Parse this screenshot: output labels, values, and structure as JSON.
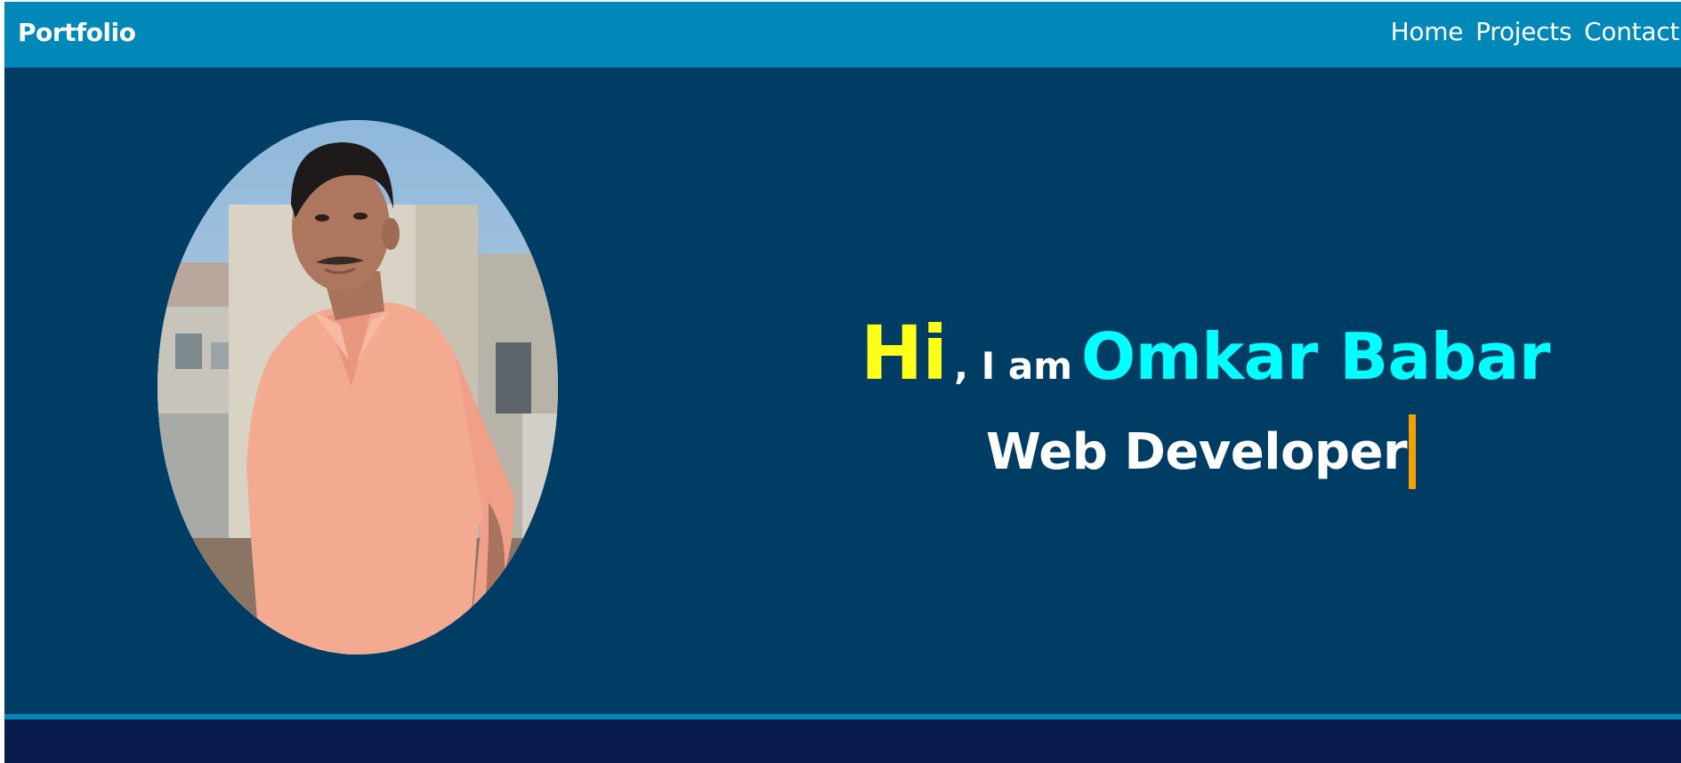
{
  "navbar": {
    "brand": "Portfolio",
    "links": [
      {
        "label": "Home"
      },
      {
        "label": "Projects"
      },
      {
        "label": "Contact"
      }
    ]
  },
  "hero": {
    "greeting_hi": "Hi",
    "greeting_iam": ", I am",
    "name": "Omkar Babar",
    "role": "Web Developer"
  },
  "colors": {
    "navbar": "#0088b8",
    "hero_background": "#003d64",
    "hi_text": "#ffff1a",
    "name_text": "#00ffff",
    "caret": "#f5a000",
    "footer": "#0a1b4e"
  }
}
